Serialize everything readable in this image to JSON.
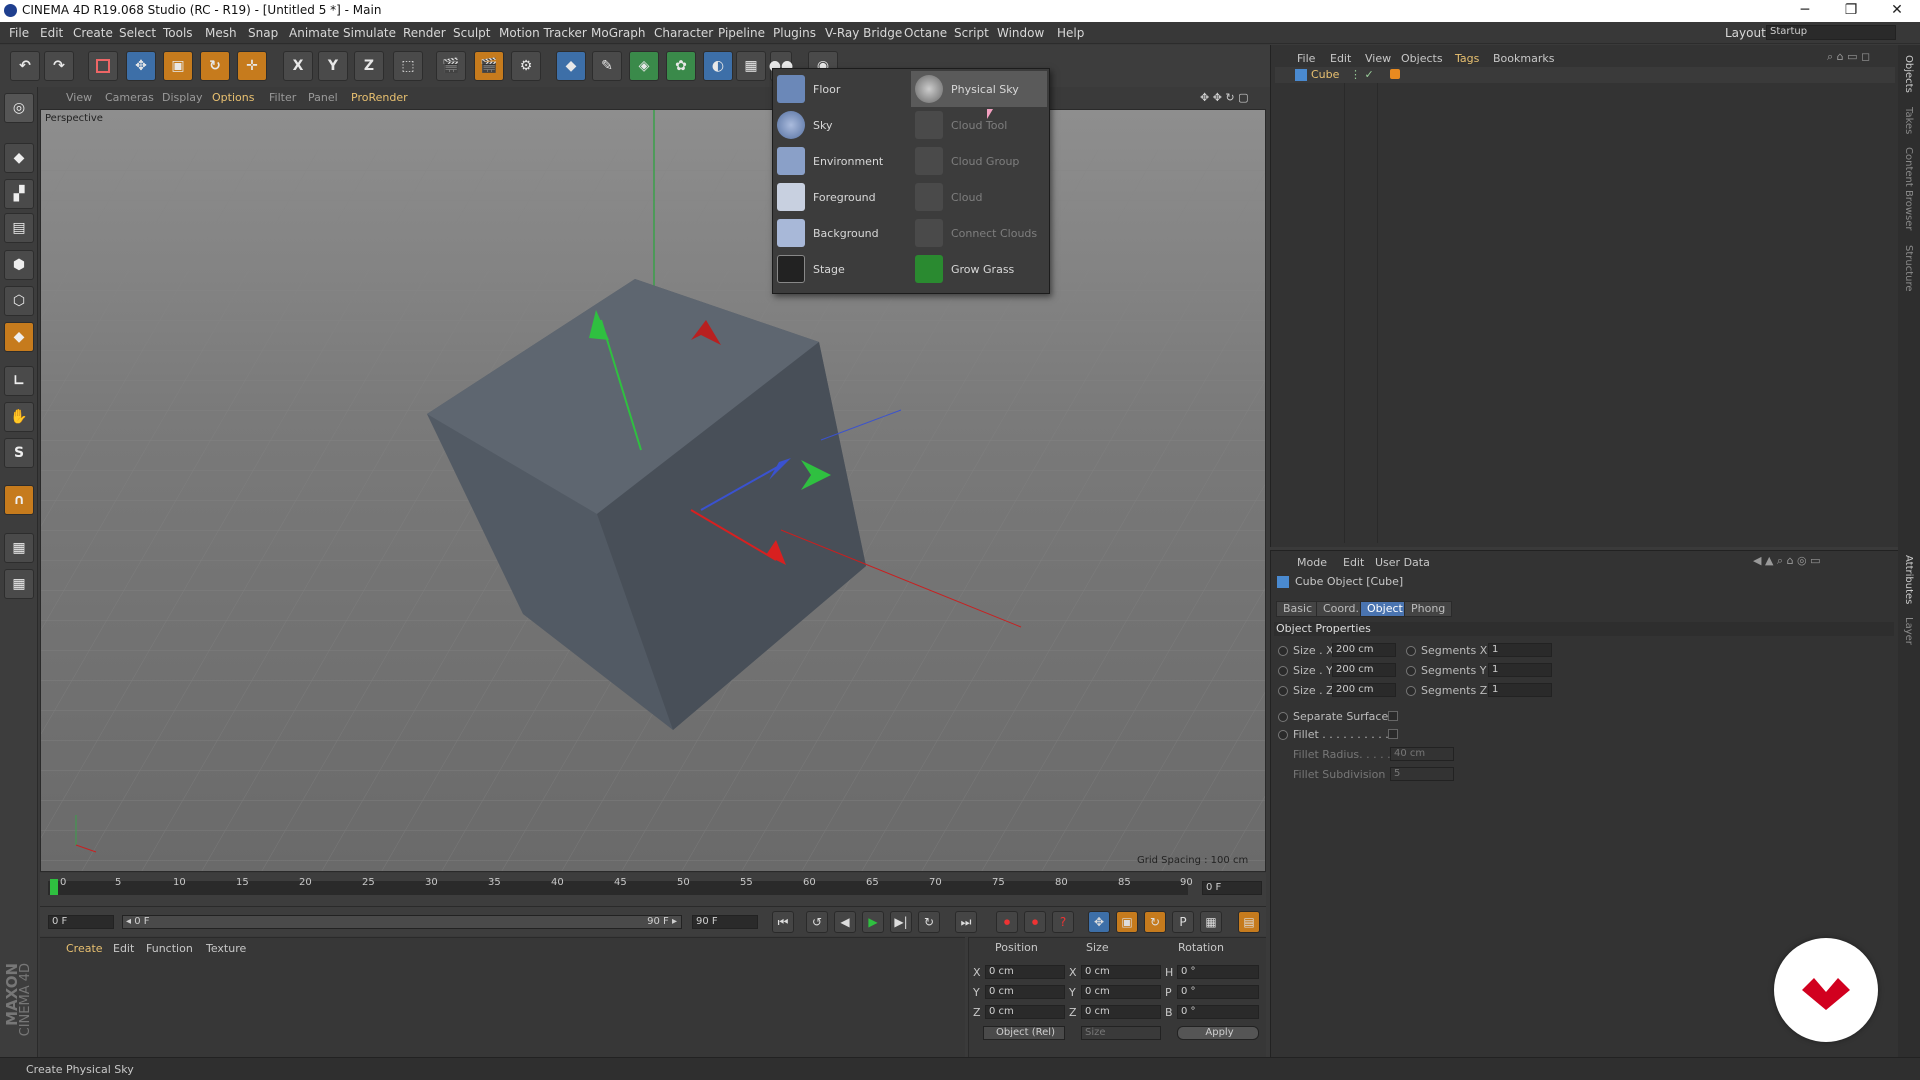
{
  "window": {
    "title": "CINEMA 4D R19.068 Studio (RC - R19) - [Untitled 5 *] - Main",
    "minimize": "─",
    "restore": "❐",
    "close": "✕"
  },
  "menubar": {
    "items": [
      "File",
      "Edit",
      "Create",
      "Select",
      "Tools",
      "Mesh",
      "Snap",
      "Animate",
      "Simulate",
      "Render",
      "Sculpt",
      "Motion Tracker",
      "MoGraph",
      "Character",
      "Pipeline",
      "Plugins",
      "V-Ray Bridge",
      "Octane",
      "Script",
      "Window",
      "Help"
    ],
    "layout_label": "Layout:",
    "layout_value": "Startup"
  },
  "toolbar": {
    "undo": "↶",
    "redo": "↷",
    "axis_x": "X",
    "axis_y": "Y",
    "axis_z": "Z"
  },
  "viewport": {
    "menu": [
      "View",
      "Cameras",
      "Display",
      "Options",
      "Filter",
      "Panel",
      "ProRender"
    ],
    "camera_label": "Perspective",
    "grid_spacing": "Grid Spacing : 100 cm"
  },
  "dropdown": {
    "left": [
      {
        "label": "Floor",
        "icon": "floor-icon"
      },
      {
        "label": "Sky",
        "icon": "sky-icon"
      },
      {
        "label": "Environment",
        "icon": "environment-icon"
      },
      {
        "label": "Foreground",
        "icon": "foreground-icon"
      },
      {
        "label": "Background",
        "icon": "background-icon"
      },
      {
        "label": "Stage",
        "icon": "stage-icon"
      }
    ],
    "right": [
      {
        "label": "Physical Sky",
        "icon": "physical-sky-icon"
      },
      {
        "label": "Cloud Tool",
        "icon": "cloud-tool-icon"
      },
      {
        "label": "Cloud Group",
        "icon": "cloud-group-icon"
      },
      {
        "label": "Cloud",
        "icon": "cloud-icon"
      },
      {
        "label": "Connect Clouds",
        "icon": "connect-clouds-icon"
      },
      {
        "label": "Grow Grass",
        "icon": "grow-grass-icon"
      }
    ]
  },
  "timeline": {
    "ticks": [
      "0",
      "5",
      "10",
      "15",
      "20",
      "25",
      "30",
      "35",
      "40",
      "45",
      "50",
      "55",
      "60",
      "65",
      "70",
      "75",
      "80",
      "85",
      "90"
    ],
    "end_frame": "0 F",
    "current": "0 F",
    "range_start": "◂ 0 F",
    "range_end": "90 F ▸",
    "max": "90 F"
  },
  "materials": {
    "menu": [
      "Create",
      "Edit",
      "Function",
      "Texture"
    ]
  },
  "coords": {
    "headers": [
      "Position",
      "Size",
      "Rotation"
    ],
    "rows": [
      {
        "a": "X",
        "pos": "0 cm",
        "s": "X",
        "size": "0 cm",
        "r": "H",
        "rot": "0 °"
      },
      {
        "a": "Y",
        "pos": "0 cm",
        "s": "Y",
        "size": "0 cm",
        "r": "P",
        "rot": "0 °"
      },
      {
        "a": "Z",
        "pos": "0 cm",
        "s": "Z",
        "size": "0 cm",
        "r": "B",
        "rot": "0 °"
      }
    ],
    "mode": "Object (Rel)",
    "size_mode": "Size",
    "apply": "Apply"
  },
  "objmgr": {
    "menu": [
      "File",
      "Edit",
      "View",
      "Objects",
      "Tags",
      "Bookmarks"
    ],
    "object_name": "Cube"
  },
  "attrmgr": {
    "menu": [
      "Mode",
      "Edit",
      "User Data"
    ],
    "title": "Cube Object [Cube]",
    "tabs": [
      "Basic",
      "Coord.",
      "Object",
      "Phong"
    ],
    "section": "Object Properties",
    "size_x_label": "Size . X",
    "size_x": "200 cm",
    "size_y_label": "Size . Y",
    "size_y": "200 cm",
    "size_z_label": "Size . Z",
    "size_z": "200 cm",
    "seg_x_label": "Segments X",
    "seg_x": "1",
    "seg_y_label": "Segments Y",
    "seg_y": "1",
    "seg_z_label": "Segments Z",
    "seg_z": "1",
    "separate": "Separate Surfaces",
    "fillet": "Fillet . . . . . . . . . .",
    "fillet_radius_label": "Fillet Radius. . . . .",
    "fillet_radius": "40 cm",
    "fillet_sub_label": "Fillet Subdivision",
    "fillet_sub": "5"
  },
  "rightstrip": [
    "Objects",
    "Takes",
    "Content Browser",
    "Structure",
    "Attributes",
    "Layer"
  ],
  "branding": {
    "maxon": "MAXON",
    "c4d": "CINEMA 4D"
  },
  "status": "Create Physical Sky",
  "colors": {
    "accent": "#4a74b0",
    "orange": "#c67b1d",
    "logo_red": "#d1001f"
  }
}
